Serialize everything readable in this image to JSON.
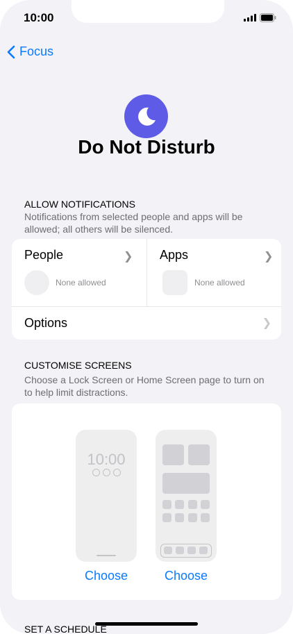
{
  "status_bar": {
    "time": "10:00"
  },
  "nav": {
    "back_label": "Focus"
  },
  "header": {
    "title": "Do Not Disturb",
    "icon": "moon-icon",
    "icon_color": "#5e5ce6"
  },
  "allow_notifications": {
    "title": "ALLOW NOTIFICATIONS",
    "description": "Notifications from selected people and apps will be allowed; all others will be silenced.",
    "people": {
      "label": "People",
      "status": "None allowed"
    },
    "apps": {
      "label": "Apps",
      "status": "None allowed"
    },
    "options_label": "Options"
  },
  "customise_screens": {
    "title": "CUSTOMISE SCREENS",
    "description": "Choose a Lock Screen or Home Screen page to turn on to help limit distractions.",
    "lock_screen": {
      "time": "10:00",
      "choose_label": "Choose"
    },
    "home_screen": {
      "choose_label": "Choose"
    }
  },
  "schedule": {
    "title": "SET A SCHEDULE"
  },
  "colors": {
    "accent": "#0a7aff",
    "background": "#f2f2f7"
  }
}
